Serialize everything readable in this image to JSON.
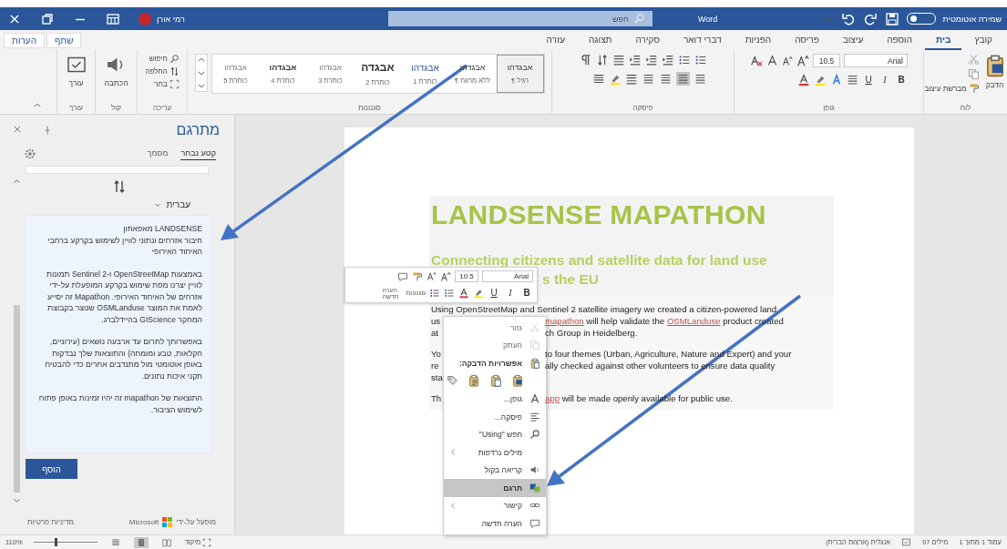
{
  "title_bar": {
    "user_name": "רמי אורן",
    "search_placeholder": "חפש",
    "document_title": "Word",
    "autosave_label": "שמירה אוטומטית",
    "autosave_on": false
  },
  "ribbon_tabs": [
    {
      "label": "קובץ",
      "selected": false
    },
    {
      "label": "בית",
      "selected": true
    },
    {
      "label": "הוספה",
      "selected": false
    },
    {
      "label": "עיצוב",
      "selected": false
    },
    {
      "label": "פריסה",
      "selected": false
    },
    {
      "label": "הפניות",
      "selected": false
    },
    {
      "label": "דברי דואר",
      "selected": false
    },
    {
      "label": "סקירה",
      "selected": false
    },
    {
      "label": "תצוגה",
      "selected": false
    },
    {
      "label": "עזרה",
      "selected": false
    }
  ],
  "share_button": "שתף",
  "comments_button": "הערות",
  "ribbon": {
    "clipboard": {
      "paste": "הדבק",
      "format_painter": "מברשת עיצוב",
      "group": "לוח"
    },
    "font": {
      "name": "Arial",
      "size": "10.5",
      "group": "גופן",
      "format_buttons": [
        {
          "label": "B",
          "on": false
        },
        {
          "label": "I",
          "on": false
        },
        {
          "label": "U",
          "on": false
        }
      ]
    },
    "paragraph": {
      "group": "פיסקה",
      "alignments": [
        {
          "selected": false
        },
        {
          "selected": true
        },
        {
          "selected": false
        },
        {
          "selected": false
        }
      ]
    },
    "styles": {
      "group": "סגנונות",
      "items": [
        {
          "kind": "normal",
          "sample": "אבגדהו",
          "name": "¶ רגיל",
          "selected": true
        },
        {
          "kind": "normal",
          "sample": "אבגדהו",
          "name": "¶ ללא מרווח",
          "selected": false
        },
        {
          "kind": "heading",
          "sample": "אבגדהו",
          "name": "כותרת 1",
          "selected": false
        },
        {
          "kind": "title",
          "sample": "אבגדה",
          "name": "כותרת 2",
          "selected": false
        },
        {
          "kind": "subtle",
          "sample": "אבגדהו",
          "name": "כותרת 3",
          "selected": false
        },
        {
          "kind": "bold",
          "sample": "אבגדהו",
          "name": "כותרת 4",
          "selected": false
        },
        {
          "kind": "subtle",
          "sample": "אבגדהו",
          "name": "כותרת 5",
          "selected": false
        }
      ]
    },
    "editing": {
      "group": "עריכה",
      "items": [
        "חיפוש",
        "החלפה",
        "בחר"
      ]
    },
    "voice": {
      "group": "קול",
      "label": "הכתבה"
    },
    "editor": {
      "group": "עורך",
      "label": "עורך"
    }
  },
  "translator": {
    "title": "מתרגם",
    "tabs": [
      {
        "label": "קטע נבחר",
        "selected": true
      },
      {
        "label": "מסמך",
        "selected": false
      }
    ],
    "target_language": "עברית",
    "paragraphs": [
      "LANDSENSE מאפאתון\nחיבור אזרחים ונתוני לוויין לשימוש בקרקע ברחבי האיחוד האירופי",
      "באמצעות OpenStreetMap ו-Sentinel 2 תמונות לוויין יצרנו מפת שימוש בקרקע המופעלת על-ידי אזרחים של האיחוד האירופי. Mapathon זה יסייע לאמת את המוצר OSMLanduse שנוצר בקבוצת המחקר GIScience בהיידלברג.",
      "באפשרותך לתרום עד ארבעה נושאים (עירוניים, חקלאות, טבע ומומחה) והתוצאות שלך נבדקות באופן אוטומטי מול מתנדבים אחרים כדי להבטיח תקני איכות נתונים.",
      "התוצאות של mapathon זה יהיו זמינות באופן פתוח לשימוש הציבור."
    ],
    "insert_button": "הוסף",
    "powered_by": "מופעל על-ידי",
    "brand": "Microsoft",
    "privacy_link": "מדיניות פרטיות"
  },
  "document": {
    "title": "LANDSENSE MAPATHON",
    "subtitle_lines": [
      "Connecting citizens and satellite data for land use",
      "s the EU"
    ],
    "paragraphs": [
      {
        "lines": [
          {
            "left": "Using OpenStreetMap and Sentinel 2 satellite imagery we created a citizen-powered land"
          },
          {
            "left": "us",
            "right": {
              "link": "mapathon",
              "text": " will help validate the ",
              "link_2": "OSMLanduse",
              "text_2": " product created"
            }
          },
          {
            "left": "at",
            "right": {
              "text": "ch Group in Heidelberg."
            }
          }
        ]
      },
      {
        "lines": [
          {
            "left": "Yo",
            "right": {
              "text": "to four themes (Urban, Agriculture, Nature and Expert) and your"
            }
          },
          {
            "left": "re",
            "right": {
              "text": "ally checked against other volunteers to ensure data quality"
            }
          },
          {
            "left": "sta"
          }
        ]
      },
      {
        "lines": [
          {
            "left": "Th",
            "right": {
              "link": "app",
              "text": " will be made openly available for public use."
            }
          }
        ]
      }
    ]
  },
  "mini_toolbar": {
    "font": "Arial",
    "size": "10.5",
    "format_buttons": [
      {
        "label": "B",
        "on": false
      },
      {
        "label": "I",
        "on": false
      },
      {
        "label": "U",
        "on": false
      }
    ],
    "styles_label": "סגנונות",
    "comment_label": "הערה חדשה"
  },
  "context_menu": {
    "items": [
      {
        "kind": "item",
        "label": "גזור",
        "disabled": true,
        "submenu": false,
        "selected": false
      },
      {
        "kind": "item",
        "label": "העתק",
        "disabled": true,
        "submenu": false,
        "selected": false
      },
      {
        "kind": "paste",
        "label": "אפשרויות הדבקה:"
      },
      {
        "kind": "item",
        "label": "גופן...",
        "disabled": false,
        "submenu": false,
        "selected": false
      },
      {
        "kind": "item",
        "label": "פיסקה...",
        "disabled": false,
        "submenu": false,
        "selected": false
      },
      {
        "kind": "item",
        "label": "חפש \"Using\"",
        "disabled": false,
        "submenu": false,
        "selected": false
      },
      {
        "kind": "item",
        "label": "מילים נרדפות",
        "disabled": false,
        "submenu": true,
        "selected": false
      },
      {
        "kind": "item",
        "label": "קריאה בקול",
        "disabled": false,
        "submenu": false,
        "selected": false
      },
      {
        "kind": "item",
        "label": "תרגם",
        "disabled": false,
        "submenu": false,
        "selected": true
      },
      {
        "kind": "item",
        "label": "קישור",
        "disabled": false,
        "submenu": true,
        "selected": false
      },
      {
        "kind": "item",
        "label": "הערה חדשה",
        "disabled": false,
        "submenu": false,
        "selected": false
      }
    ]
  },
  "status_bar": {
    "page": "עמוד 1 מתוך 1",
    "words": "97 מילים",
    "language": "אנגלית (ארצות הברית)",
    "focus": "מיקוד",
    "views": [
      {
        "selected": false
      },
      {
        "selected": true
      },
      {
        "selected": false
      }
    ],
    "zoom": {
      "level": 0.35,
      "label": "110%"
    }
  }
}
